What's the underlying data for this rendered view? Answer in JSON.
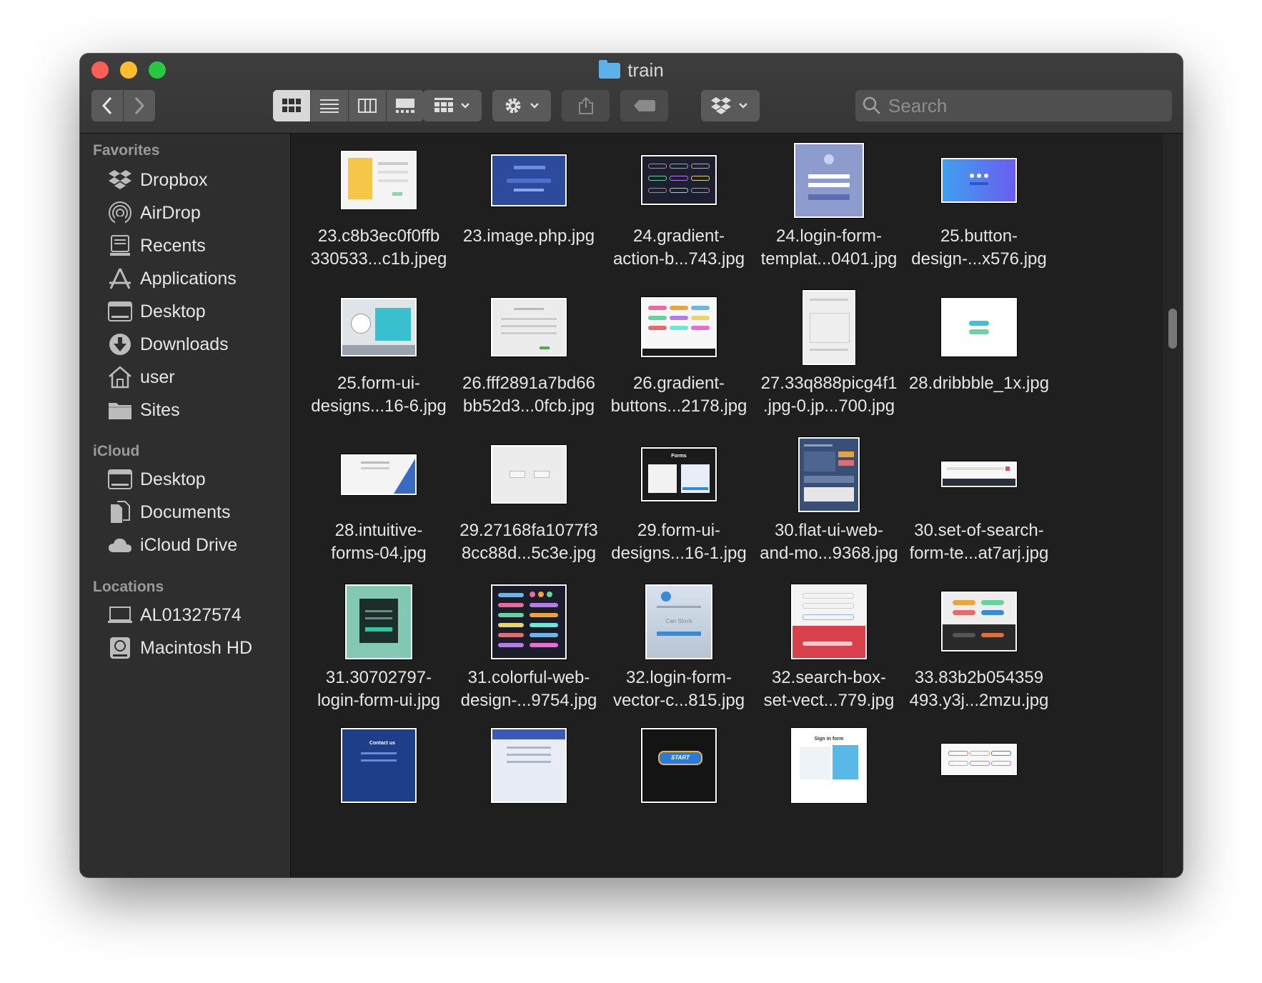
{
  "window": {
    "title": "train"
  },
  "toolbar": {
    "search_placeholder": "Search"
  },
  "sidebar": {
    "sections": [
      {
        "label": "Favorites",
        "items": [
          {
            "label": "Dropbox",
            "icon": "dropbox-icon"
          },
          {
            "label": "AirDrop",
            "icon": "airdrop-icon"
          },
          {
            "label": "Recents",
            "icon": "recents-icon"
          },
          {
            "label": "Applications",
            "icon": "applications-icon"
          },
          {
            "label": "Desktop",
            "icon": "desktop-icon"
          },
          {
            "label": "Downloads",
            "icon": "downloads-icon"
          },
          {
            "label": "user",
            "icon": "home-icon"
          },
          {
            "label": "Sites",
            "icon": "folder-icon"
          }
        ]
      },
      {
        "label": "iCloud",
        "items": [
          {
            "label": "Desktop",
            "icon": "desktop-icon"
          },
          {
            "label": "Documents",
            "icon": "documents-icon"
          },
          {
            "label": "iCloud Drive",
            "icon": "cloud-icon"
          }
        ]
      },
      {
        "label": "Locations",
        "items": [
          {
            "label": "AL01327574",
            "icon": "laptop-icon"
          },
          {
            "label": "Macintosh HD",
            "icon": "disk-icon"
          }
        ]
      }
    ]
  },
  "files": [
    {
      "line1": "23.c8b3ec0f0ffb",
      "line2": "330533...c1b.jpeg"
    },
    {
      "line1": "23.image.php.jpg",
      "line2": ""
    },
    {
      "line1": "24.gradient-",
      "line2": "action-b...743.jpg"
    },
    {
      "line1": "24.login-form-",
      "line2": "templat...0401.jpg"
    },
    {
      "line1": "25.button-",
      "line2": "design-...x576.jpg"
    },
    {
      "line1": "25.form-ui-",
      "line2": "designs...16-6.jpg"
    },
    {
      "line1": "26.fff2891a7bd66",
      "line2": "bb52d3...0fcb.jpg"
    },
    {
      "line1": "26.gradient-",
      "line2": "buttons...2178.jpg"
    },
    {
      "line1": "27.33q888picg4f1",
      "line2": ".jpg-0.jp...700.jpg"
    },
    {
      "line1": "28.dribbble_1x.jpg",
      "line2": ""
    },
    {
      "line1": "28.intuitive-",
      "line2": "forms-04.jpg"
    },
    {
      "line1": "29.27168fa1077f3",
      "line2": "8cc88d...5c3e.jpg"
    },
    {
      "line1": "29.form-ui-",
      "line2": "designs...16-1.jpg"
    },
    {
      "line1": "30.flat-ui-web-",
      "line2": "and-mo...9368.jpg"
    },
    {
      "line1": "30.set-of-search-",
      "line2": "form-te...at7arj.jpg"
    },
    {
      "line1": "31.30702797-",
      "line2": "login-form-ui.jpg"
    },
    {
      "line1": "31.colorful-web-",
      "line2": "design-...9754.jpg"
    },
    {
      "line1": "32.login-form-",
      "line2": "vector-c...815.jpg"
    },
    {
      "line1": "32.search-box-",
      "line2": "set-vect...779.jpg"
    },
    {
      "line1": "33.83b2b054359",
      "line2": "493.y3j...2mzu.jpg"
    },
    {
      "line1": "",
      "line2": ""
    },
    {
      "line1": "",
      "line2": ""
    },
    {
      "line1": "",
      "line2": ""
    },
    {
      "line1": "",
      "line2": ""
    },
    {
      "line1": "",
      "line2": ""
    }
  ],
  "thumb_text": {
    "forms": "Forms",
    "start": "START",
    "signin": "Sign in form",
    "contact": "Contact us",
    "canstock": "Can Stock"
  }
}
